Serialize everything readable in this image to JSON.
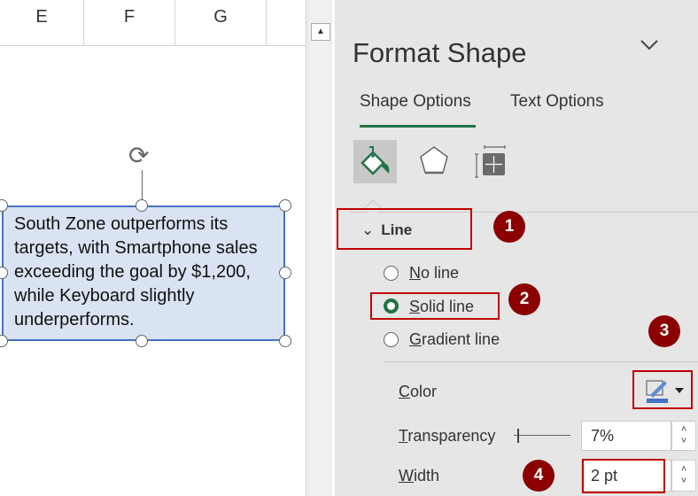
{
  "sheet": {
    "columns": [
      "E",
      "F",
      "G"
    ]
  },
  "textbox": {
    "text": "South Zone outperforms its targets, with Smartphone sales exceeding the goal by $1,200, while Keyboard slightly underperforms."
  },
  "panel": {
    "title": "Format Shape",
    "tabs": [
      {
        "label": "Shape Options",
        "active": true
      },
      {
        "label": "Text Options",
        "active": false
      }
    ],
    "section": "Line",
    "line_options": [
      {
        "label": "No line",
        "key": "N",
        "rest": "o line",
        "selected": false
      },
      {
        "label": "Solid line",
        "key": "S",
        "rest": "olid line",
        "selected": true
      },
      {
        "label": "Gradient line",
        "key": "G",
        "rest": "radient line",
        "selected": false
      }
    ],
    "color": {
      "label": "Color",
      "key": "C",
      "rest": "olor",
      "value": "#4472c4"
    },
    "transparency": {
      "label": "Transparency",
      "key": "T",
      "rest": "ransparency",
      "value": "7%",
      "percent": 7
    },
    "width": {
      "label": "Width",
      "key": "W",
      "rest": "idth",
      "value": "2 pt"
    }
  },
  "badges": [
    "1",
    "2",
    "3",
    "4"
  ],
  "colors": {
    "accent": "#217346",
    "highlight": "#c00000",
    "badge": "#8b0000",
    "shape_fill": "#dae3f3",
    "shape_border": "#4472c4"
  }
}
